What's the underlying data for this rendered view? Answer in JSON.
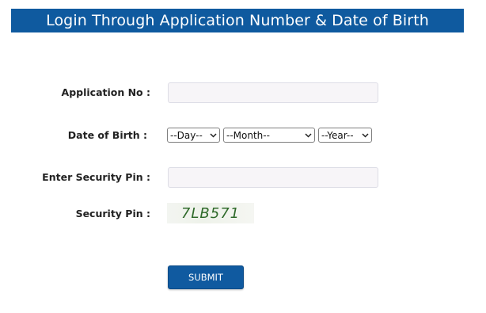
{
  "header": {
    "title": "Login Through Application Number & Date of Birth"
  },
  "form": {
    "application_no_label": "Application No :",
    "application_no_value": "",
    "dob_label": "Date of Birth :",
    "dob_day": "--Day--",
    "dob_month": "--Month--",
    "dob_year": "--Year--",
    "security_pin_input_label": "Enter Security Pin :",
    "security_pin_input_value": "",
    "security_pin_label": "Security Pin :",
    "captcha_text": "7LB571",
    "submit_label": "SUBMIT"
  },
  "colors": {
    "header_bg": "#0f5a9f",
    "submit_bg": "#105aa0",
    "captcha_text": "#2f6a2a"
  },
  "icons": {
    "select_arrow": "chevron-down-icon"
  }
}
